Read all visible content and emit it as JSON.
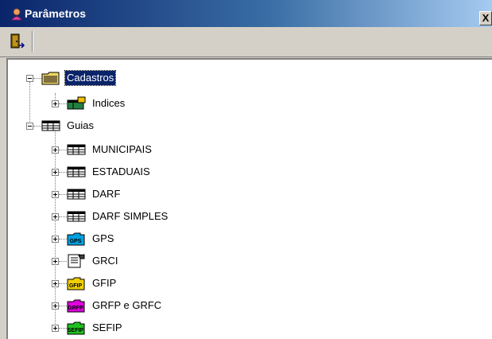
{
  "window": {
    "title": "Parâmetros",
    "close_label": "X"
  },
  "toolbar": {
    "exit_icon": "door-exit-icon"
  },
  "tree": {
    "nodes": [
      {
        "label": "Cadastros",
        "icon": "folder-icon",
        "expander": "minus",
        "selected": true
      },
      {
        "label": "Indices",
        "icon": "index-table-icon",
        "expander": "plus"
      },
      {
        "label": "Guias",
        "icon": "table-icon",
        "expander": "minus"
      },
      {
        "label": "MUNICIPAIS",
        "icon": "table-icon",
        "expander": "plus"
      },
      {
        "label": "ESTADUAIS",
        "icon": "table-icon",
        "expander": "plus"
      },
      {
        "label": "DARF",
        "icon": "table-icon",
        "expander": "plus"
      },
      {
        "label": "DARF SIMPLES",
        "icon": "table-icon",
        "expander": "plus"
      },
      {
        "label": "GPS",
        "icon": "gps-folder-icon",
        "expander": "plus"
      },
      {
        "label": "GRCI",
        "icon": "document-icon",
        "expander": "plus"
      },
      {
        "label": "GFIP",
        "icon": "gfip-folder-icon",
        "expander": "plus"
      },
      {
        "label": "GRFP e GRFC",
        "icon": "grfp-folder-icon",
        "expander": "plus"
      },
      {
        "label": "SEFIP",
        "icon": "sefip-folder-icon",
        "expander": "plus"
      }
    ]
  },
  "colors": {
    "titlebar": "#0a246a",
    "selection": "#0a246a",
    "gps": "#00a0e0",
    "gfip": "#f0d000",
    "grfp": "#e000e0",
    "sefip": "#20c020"
  }
}
